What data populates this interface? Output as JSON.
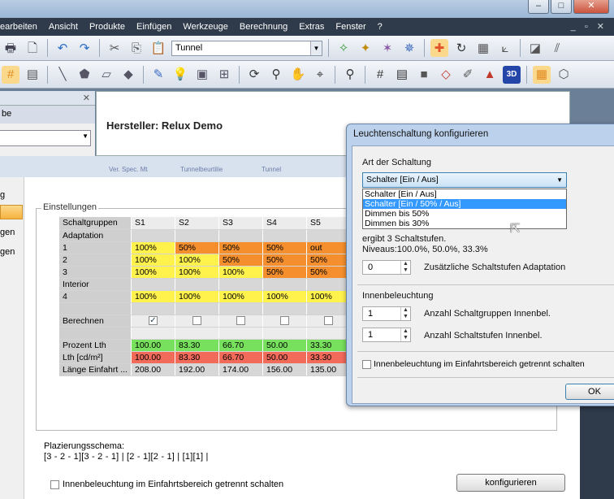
{
  "window": {
    "min": "–",
    "max": "□",
    "close": "✕"
  },
  "menu": [
    "earbeiten",
    "Ansicht",
    "Produkte",
    "Einfügen",
    "Werkzeuge",
    "Berechnung",
    "Extras",
    "Fenster",
    "?"
  ],
  "menu_mdi": "_ ▫ ✕",
  "toolbar": {
    "combo_value": "Tunnel"
  },
  "left_panel": {
    "header_text": "be",
    "close": "✕"
  },
  "main": {
    "title": "Hersteller: Relux Demo"
  },
  "tabs": [
    "Ver. Spec. Mt",
    "Tunnelbeurtilie",
    "Tunnel"
  ],
  "nav": [
    "g",
    "gen",
    "gen"
  ],
  "settings": {
    "legend": "Einstellungen",
    "header": [
      "Schaltgruppen",
      "S1",
      "S2",
      "S3",
      "S4",
      "S5"
    ],
    "rows": [
      {
        "label": "Adaptation",
        "cells": [
          "",
          "",
          "",
          "",
          ""
        ],
        "colors": [
          "n",
          "n",
          "n",
          "n",
          "n"
        ]
      },
      {
        "label": "1",
        "cells": [
          "100%",
          "50%",
          "50%",
          "50%",
          "out"
        ],
        "colors": [
          "y",
          "o",
          "o",
          "o",
          "o"
        ]
      },
      {
        "label": "2",
        "cells": [
          "100%",
          "100%",
          "50%",
          "50%",
          "50%"
        ],
        "colors": [
          "y",
          "y",
          "o",
          "o",
          "o"
        ]
      },
      {
        "label": "3",
        "cells": [
          "100%",
          "100%",
          "100%",
          "50%",
          "50%"
        ],
        "colors": [
          "y",
          "y",
          "y",
          "o",
          "o"
        ]
      },
      {
        "label": "Interior",
        "cells": [
          "",
          "",
          "",
          "",
          ""
        ],
        "colors": [
          "n",
          "n",
          "n",
          "n",
          "n"
        ]
      },
      {
        "label": "4",
        "cells": [
          "100%",
          "100%",
          "100%",
          "100%",
          "100%"
        ],
        "colors": [
          "y",
          "y",
          "y",
          "y",
          "y"
        ]
      },
      {
        "label": "",
        "cells": [
          "",
          "",
          "",
          "",
          ""
        ],
        "colors": [
          "n",
          "n",
          "n",
          "n",
          "n"
        ]
      },
      {
        "label": "Berechnen",
        "cells": [
          "☑",
          "☐",
          "☐",
          "☐",
          "☐"
        ],
        "colors": [
          "e",
          "e",
          "e",
          "e",
          "e"
        ]
      },
      {
        "label": "",
        "cells": [
          "",
          "",
          "",
          "",
          ""
        ],
        "colors": [
          "e",
          "e",
          "e",
          "e",
          "e"
        ]
      },
      {
        "label": "Prozent Lth",
        "cells": [
          "100.00",
          "83.30",
          "66.70",
          "50.00",
          "33.30"
        ],
        "colors": [
          "g",
          "g",
          "g",
          "g",
          "g"
        ]
      },
      {
        "label": "Lth [cd/m²]",
        "cells": [
          "100.00",
          "83.30",
          "66.70",
          "50.00",
          "33.30"
        ],
        "colors": [
          "r",
          "r",
          "r",
          "r",
          "r"
        ]
      },
      {
        "label": "Länge Einfahrt ...",
        "cells": [
          "208.00",
          "192.00",
          "174.00",
          "156.00",
          "135.00"
        ],
        "colors": [
          "n",
          "n",
          "n",
          "n",
          "n"
        ]
      }
    ]
  },
  "schema": {
    "label": "Plazierungsschema:",
    "value": "[3 - 2 - 1][3 - 2 - 1] | [2 - 1][2 - 1] | [1][1] |"
  },
  "bottom": {
    "checkbox_label": "Innenbeleuchtung im Einfahrtsbereich getrennt schalten",
    "konfigurieren": "konfigurieren"
  },
  "dialog": {
    "title": "Leuchtenschaltung konfigurieren",
    "art_label": "Art der Schaltung",
    "selected": "Schalter [Ein / Aus]",
    "options": [
      "Schalter [Ein / Aus]",
      "Schalter [Ein / 50% / Aus]",
      "Dimmen bis 50%",
      "Dimmen bis 30%"
    ],
    "ergibt": "ergibt 3 Schaltstufen.",
    "niveaus": "Niveaus:100.0%, 50.0%, 33.3%",
    "adapt_value": "0",
    "adapt_label": "Zusätzliche Schaltstufen Adaptation",
    "innen_title": "Innenbeleuchtung",
    "gruppen_value": "1",
    "gruppen_label": "Anzahl Schaltgruppen Innenbel.",
    "stufen_value": "1",
    "stufen_label": "Anzahl Schaltstufen Innenbel.",
    "checkbox_label": "Innenbeleuchtung im Einfahrtsbereich getrennt schalten",
    "ok": "OK"
  }
}
